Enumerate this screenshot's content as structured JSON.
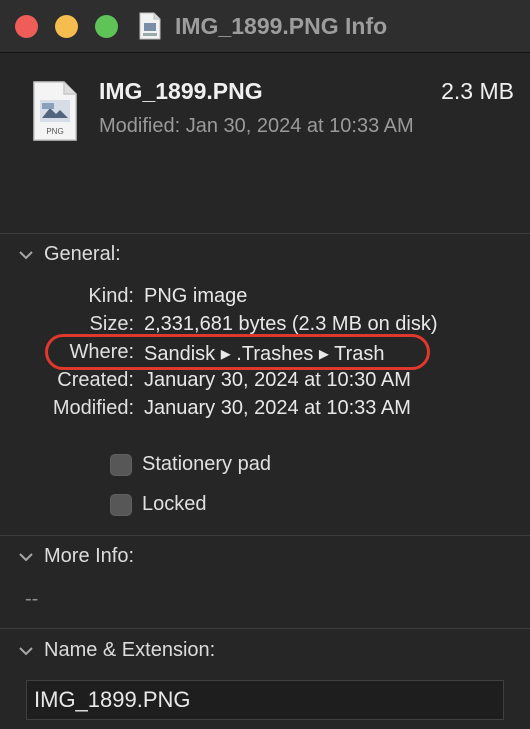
{
  "window": {
    "title": "IMG_1899.PNG Info"
  },
  "header": {
    "file_name": "IMG_1899.PNG",
    "size": "2.3 MB",
    "modified": "Modified: Jan 30, 2024 at 10:33 AM"
  },
  "icon_badge": "PNG",
  "general": {
    "heading": "General:",
    "rows": [
      {
        "key": "Kind:",
        "value": "PNG image"
      },
      {
        "key": "Size:",
        "value": "2,331,681 bytes (2.3 MB on disk)"
      },
      {
        "key": "Where:",
        "value": "Sandisk ▸ .Trashes ▸ Trash"
      },
      {
        "key": "Created:",
        "value": "January 30, 2024 at 10:30 AM"
      },
      {
        "key": "Modified:",
        "value": "January 30, 2024 at 10:33 AM"
      }
    ],
    "stationery_label": "Stationery pad",
    "locked_label": "Locked"
  },
  "more_info": {
    "heading": "More Info:",
    "value": "--"
  },
  "name_ext": {
    "heading": "Name & Extension:",
    "value": "IMG_1899.PNG"
  },
  "colors": {
    "highlight_ring": "#e0382c",
    "close": "#ee5d58",
    "minimize": "#f5bd4f",
    "zoom": "#5fc457"
  }
}
